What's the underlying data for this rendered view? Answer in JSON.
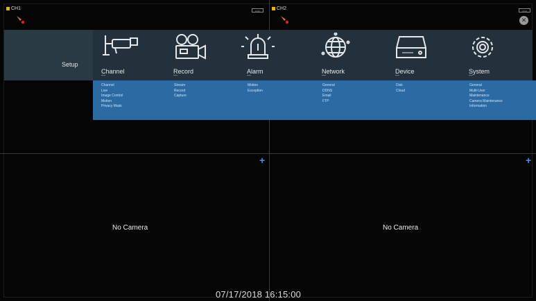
{
  "channels": [
    {
      "label": "CH1",
      "badge": "▭▭",
      "no_camera": "No Camera"
    },
    {
      "label": "CH2",
      "badge": "▭▭",
      "no_camera": "No Camera"
    }
  ],
  "setup": {
    "title": "Setup",
    "menu": [
      {
        "label": "Channel",
        "icon": "camera-icon",
        "items": [
          "Channel",
          "Live",
          "Image Control",
          "Motion",
          "Privacy Mask"
        ]
      },
      {
        "label": "Record",
        "icon": "video-camera-icon",
        "items": [
          "Stream",
          "Record",
          "Capture"
        ]
      },
      {
        "label": "Alarm",
        "icon": "alarm-light-icon",
        "items": [
          "Motion",
          "Exception"
        ]
      },
      {
        "label": "Network",
        "icon": "globe-icon",
        "items": [
          "General",
          "DDNS",
          "Email",
          "FTP"
        ]
      },
      {
        "label": "Device",
        "icon": "hdd-icon",
        "items": [
          "Disk",
          "Cloud"
        ]
      },
      {
        "label": "System",
        "icon": "gear-icon",
        "items": [
          "General",
          "Multi-User",
          "Maintenance",
          "Camera Maintenance",
          "Information"
        ]
      }
    ]
  },
  "status": {
    "datetime": "07/17/2018 16:15:00"
  },
  "colors": {
    "submenu_bg": "#2b6aa3",
    "setup_bg": "#22313b",
    "plus": "#4a90e2"
  }
}
